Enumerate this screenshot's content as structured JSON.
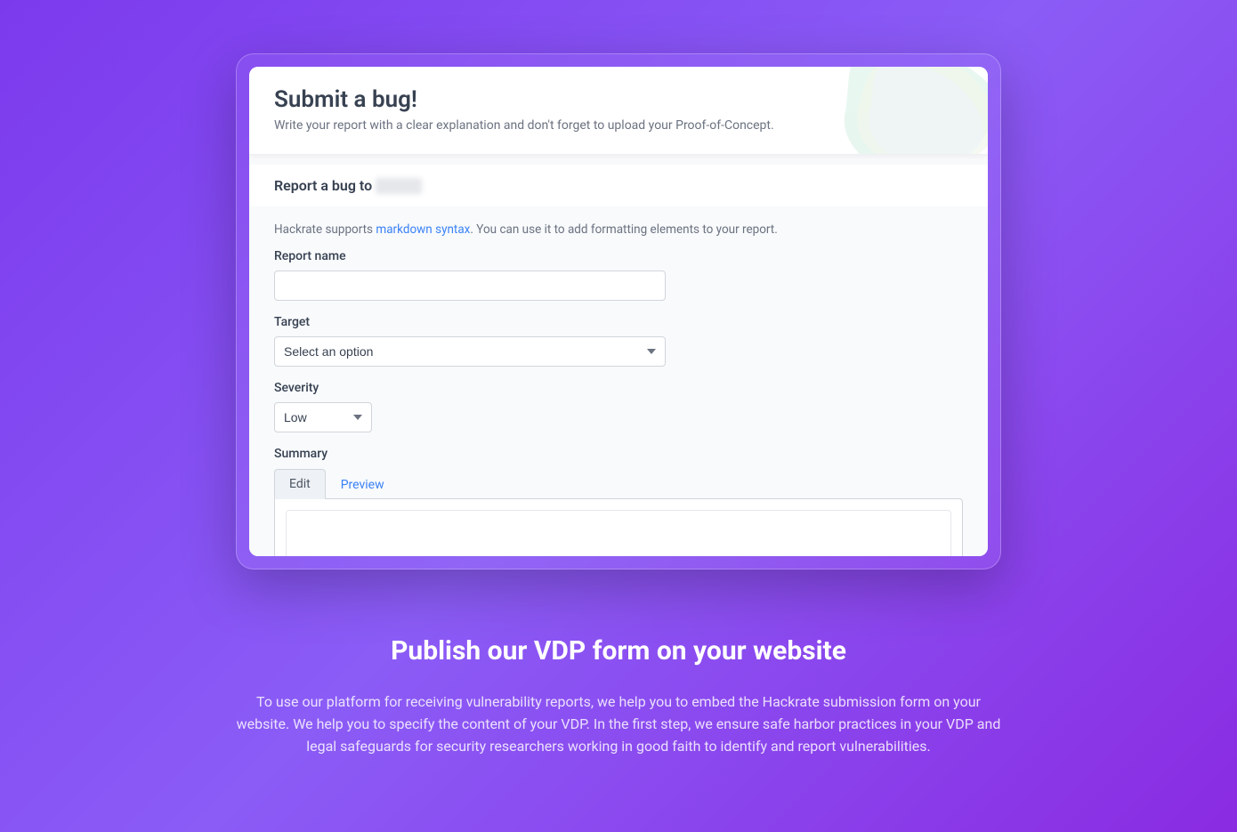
{
  "header": {
    "title": "Submit a bug!",
    "subtitle": "Write your report with a clear explanation and don't forget to upload your Proof-of-Concept."
  },
  "section": {
    "prefix": "Report a bug to "
  },
  "hint": {
    "before": "Hackrate supports ",
    "link": "markdown syntax",
    "after": ". You can use it to add formatting elements to your report."
  },
  "fields": {
    "report_name": {
      "label": "Report name",
      "value": ""
    },
    "target": {
      "label": "Target",
      "selected": "Select an option"
    },
    "severity": {
      "label": "Severity",
      "selected": "Low"
    },
    "summary": {
      "label": "Summary",
      "value": ""
    }
  },
  "tabs": {
    "edit": "Edit",
    "preview": "Preview"
  },
  "marketing": {
    "heading": "Publish our VDP form on your website",
    "body": "To use our platform for receiving vulnerability reports, we help you to embed the Hackrate submission form on your website. We help you to specify the content of your VDP. In the first step, we ensure safe harbor practices in your VDP and legal safeguards for security researchers working in good faith to identify and report vulnerabilities."
  }
}
